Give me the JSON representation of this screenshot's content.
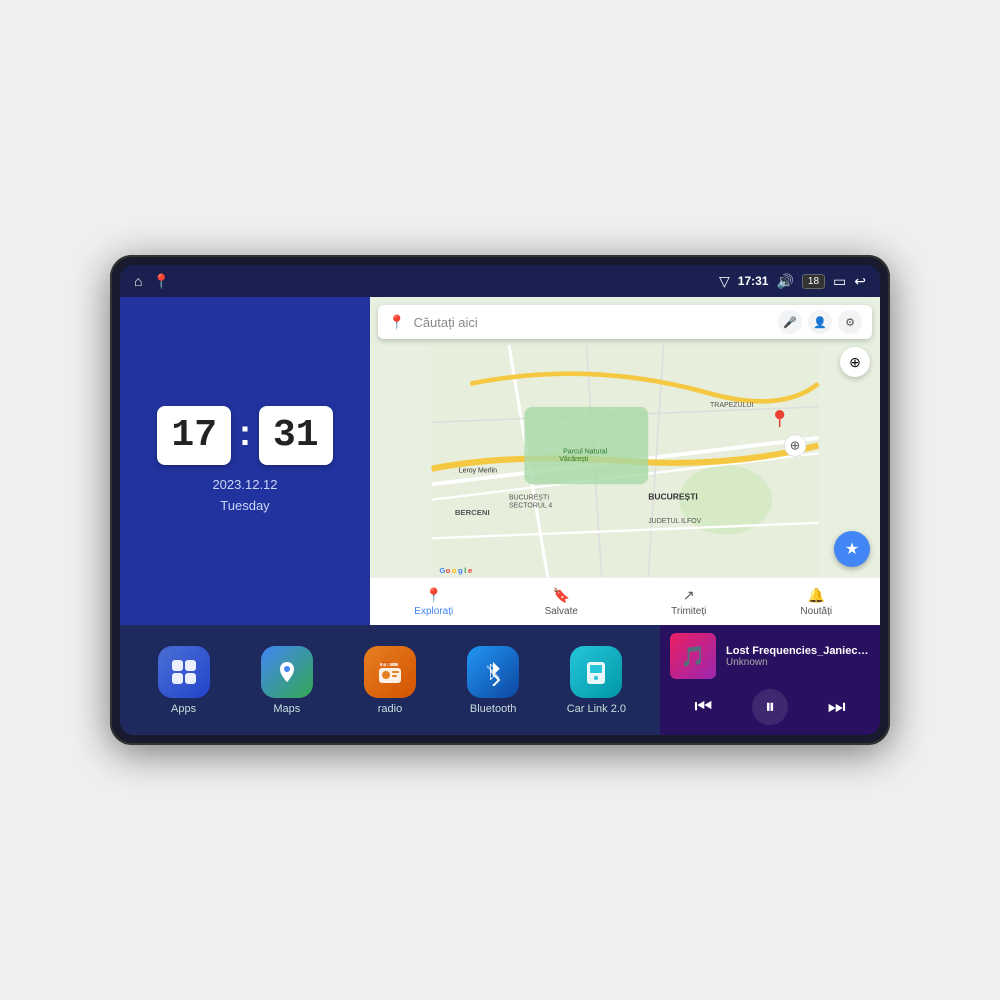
{
  "device": {
    "status_bar": {
      "left_icons": [
        "home",
        "maps"
      ],
      "signal_icon": "▽",
      "time": "17:31",
      "volume_icon": "🔊",
      "battery_level": "18",
      "battery_icon": "🔋",
      "back_icon": "↩"
    },
    "clock": {
      "hour": "17",
      "minute": "31",
      "date": "2023.12.12",
      "day": "Tuesday"
    },
    "map": {
      "search_placeholder": "Căutați aici",
      "nav_items": [
        {
          "label": "Explorați",
          "icon": "📍",
          "active": true
        },
        {
          "label": "Salvate",
          "icon": "🔖",
          "active": false
        },
        {
          "label": "Trimiteți",
          "icon": "🔁",
          "active": false
        },
        {
          "label": "Noutăți",
          "icon": "🔔",
          "active": false
        }
      ],
      "places": [
        "Parcul Natural Văcărești",
        "Leroy Merlin",
        "BERCENI",
        "BUCUREȘTI",
        "JUDEȚUL ILFOV",
        "TRAPEZULUI",
        "BUCUREȘTI SECTORUL 4"
      ]
    },
    "apps": [
      {
        "id": "apps",
        "label": "Apps",
        "icon": "⊞",
        "color_class": "icon-apps"
      },
      {
        "id": "maps",
        "label": "Maps",
        "icon": "🗺",
        "color_class": "icon-maps"
      },
      {
        "id": "radio",
        "label": "radio",
        "icon": "📻",
        "color_class": "icon-radio"
      },
      {
        "id": "bluetooth",
        "label": "Bluetooth",
        "icon": "🔵",
        "color_class": "icon-bluetooth"
      },
      {
        "id": "carlink",
        "label": "Car Link 2.0",
        "icon": "📱",
        "color_class": "icon-carlink"
      }
    ],
    "music": {
      "title": "Lost Frequencies_Janieck Devy-...",
      "artist": "Unknown",
      "thumbnail_emoji": "🎵"
    }
  }
}
